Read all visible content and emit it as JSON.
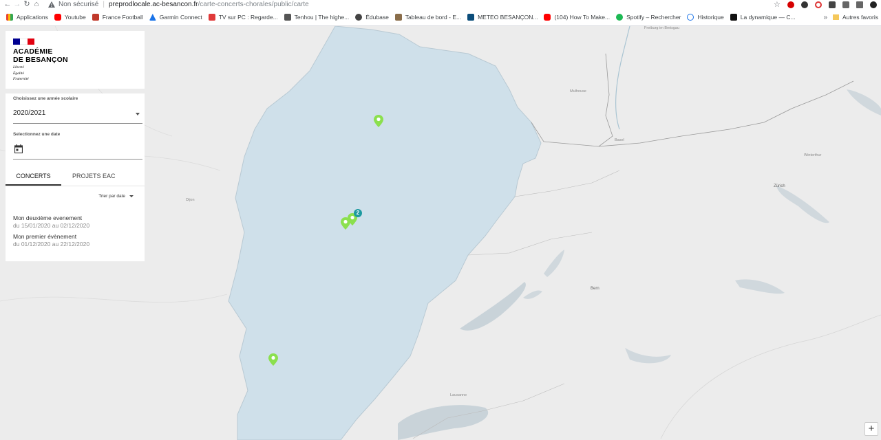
{
  "browser": {
    "insecure_label": "Non sécurisé",
    "url_host": "preprodlocale.ac-besancon.fr",
    "url_path": "/carte-concerts-chorales/public/carte",
    "bookmarks": [
      "Applications",
      "Youtube",
      "France Football",
      "Garmin Connect",
      "TV sur PC : Regarde...",
      "Tenhou | The highe...",
      "Édubase",
      "Tableau de bord - E...",
      "METEO BESANÇON...",
      "(104) How To Make...",
      "Spotify – Rechercher",
      "Historique",
      "La dynamique — C..."
    ],
    "bookmark_more": "»",
    "other_bookmarks": "Autres favoris",
    "colors": {
      "youtube": "#ff0000",
      "spotify": "#1db954",
      "garmin": "#1a73e8",
      "folder": "#f5c85b"
    }
  },
  "logo": {
    "line1": "ACADÉMIE",
    "line2": "DE BESANÇON",
    "motto1": "Liberté",
    "motto2": "Égalité",
    "motto3": "Fraternité",
    "flag_colors": [
      "#000091",
      "#ffffff",
      "#e1000f"
    ]
  },
  "filters": {
    "year_label": "Choisissez une année scolaire",
    "year_value": "2020/2021",
    "date_label": "Selectionnez une date",
    "calendar_icon": "calendar-icon"
  },
  "tabs": [
    {
      "label": "CONCERTS",
      "active": true
    },
    {
      "label": "PROJETS EAC",
      "active": false
    }
  ],
  "sort_label": "Trier par date",
  "events": [
    {
      "title": "Mon deuxième evenement",
      "dates": "du 15/01/2020 au 02/12/2020"
    },
    {
      "title": "Mon premier évènement",
      "dates": "du 01/12/2020 au 22/12/2020"
    }
  ],
  "map": {
    "region_color": "#cfe0ea",
    "marker_color": "#8be04e",
    "cluster_color": "#1d9aa0",
    "cluster_count": "2",
    "zoom_in": "+",
    "place_labels": [
      "Freiburg im Breisgau",
      "Mulhouse",
      "Basel",
      "Winterthur",
      "Zürich",
      "Dijon",
      "Bern",
      "Lausanne"
    ]
  }
}
